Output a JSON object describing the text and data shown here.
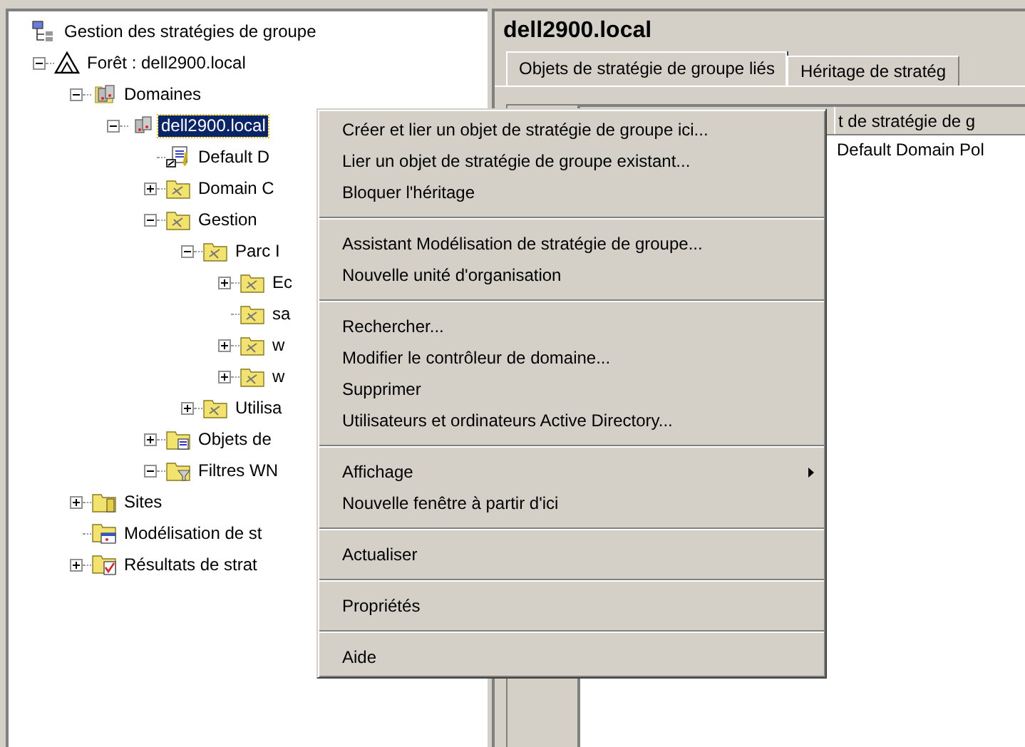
{
  "tree": [
    {
      "label": "Gestion des stratégies de groupe",
      "kind": "root",
      "selected": false,
      "children": [
        {
          "label": "Forêt : dell2900.local",
          "kind": "forest",
          "expanded": true,
          "selected": false,
          "children": [
            {
              "label": "Domaines",
              "kind": "domains",
              "expanded": true,
              "selected": false,
              "children": [
                {
                  "label": "dell2900.local",
                  "kind": "domain",
                  "expanded": true,
                  "selected": true,
                  "children": [
                    {
                      "label": "Default D",
                      "kind": "gpo",
                      "selected": false
                    },
                    {
                      "label": "Domain C",
                      "kind": "ou",
                      "expanded": false,
                      "selected": false
                    },
                    {
                      "label": "Gestion",
                      "kind": "ou",
                      "expanded": true,
                      "selected": false,
                      "children": [
                        {
                          "label": "Parc I",
                          "kind": "ou",
                          "expanded": true,
                          "selected": false,
                          "children": [
                            {
                              "label": "Ec",
                              "kind": "ou",
                              "expanded": false,
                              "selected": false
                            },
                            {
                              "label": "sa",
                              "kind": "ou",
                              "selected": false
                            },
                            {
                              "label": "w",
                              "kind": "ou",
                              "expanded": false,
                              "selected": false
                            },
                            {
                              "label": "w",
                              "kind": "ou",
                              "expanded": false,
                              "selected": false
                            }
                          ]
                        },
                        {
                          "label": "Utilisa",
                          "kind": "ou",
                          "expanded": false,
                          "selected": false
                        }
                      ]
                    },
                    {
                      "label": "Objets de",
                      "kind": "gpofolder",
                      "expanded": false,
                      "selected": false
                    },
                    {
                      "label": "Filtres WN",
                      "kind": "wmifolder",
                      "expanded": true,
                      "selected": false
                    }
                  ]
                }
              ]
            },
            {
              "label": "Sites",
              "kind": "sites",
              "expanded": false,
              "selected": false
            },
            {
              "label": "Modélisation de st",
              "kind": "modeling",
              "selected": false
            },
            {
              "label": "Résultats de strat",
              "kind": "results",
              "expanded": false,
              "selected": false
            }
          ]
        }
      ]
    }
  ],
  "details": {
    "title": "dell2900.local",
    "tabs": [
      {
        "label": "Objets de stratégie de groupe liés",
        "selected": true
      },
      {
        "label": "Héritage de stratég",
        "selected": false
      }
    ],
    "table": {
      "columns": [
        "t de stratégie de g"
      ],
      "rows": [
        [
          "Default Domain Pol"
        ]
      ]
    }
  },
  "context_menu": [
    {
      "kind": "item",
      "label": "Créer et lier un objet de stratégie de groupe ici..."
    },
    {
      "kind": "item",
      "label": "Lier un objet de stratégie de groupe existant..."
    },
    {
      "kind": "item",
      "label": "Bloquer l'héritage"
    },
    {
      "kind": "separator"
    },
    {
      "kind": "item",
      "label": "Assistant Modélisation de stratégie de groupe..."
    },
    {
      "kind": "item",
      "label": "Nouvelle unité d'organisation"
    },
    {
      "kind": "separator"
    },
    {
      "kind": "item",
      "label": "Rechercher..."
    },
    {
      "kind": "item",
      "label": "Modifier le contrôleur de domaine..."
    },
    {
      "kind": "item",
      "label": "Supprimer"
    },
    {
      "kind": "item",
      "label": "Utilisateurs et ordinateurs Active Directory..."
    },
    {
      "kind": "separator"
    },
    {
      "kind": "submenu",
      "label": "Affichage"
    },
    {
      "kind": "item",
      "label": "Nouvelle fenêtre à partir d'ici"
    },
    {
      "kind": "separator"
    },
    {
      "kind": "item",
      "label": "Actualiser"
    },
    {
      "kind": "separator"
    },
    {
      "kind": "item",
      "label": "Propriétés"
    },
    {
      "kind": "separator"
    },
    {
      "kind": "item",
      "label": "Aide"
    }
  ]
}
